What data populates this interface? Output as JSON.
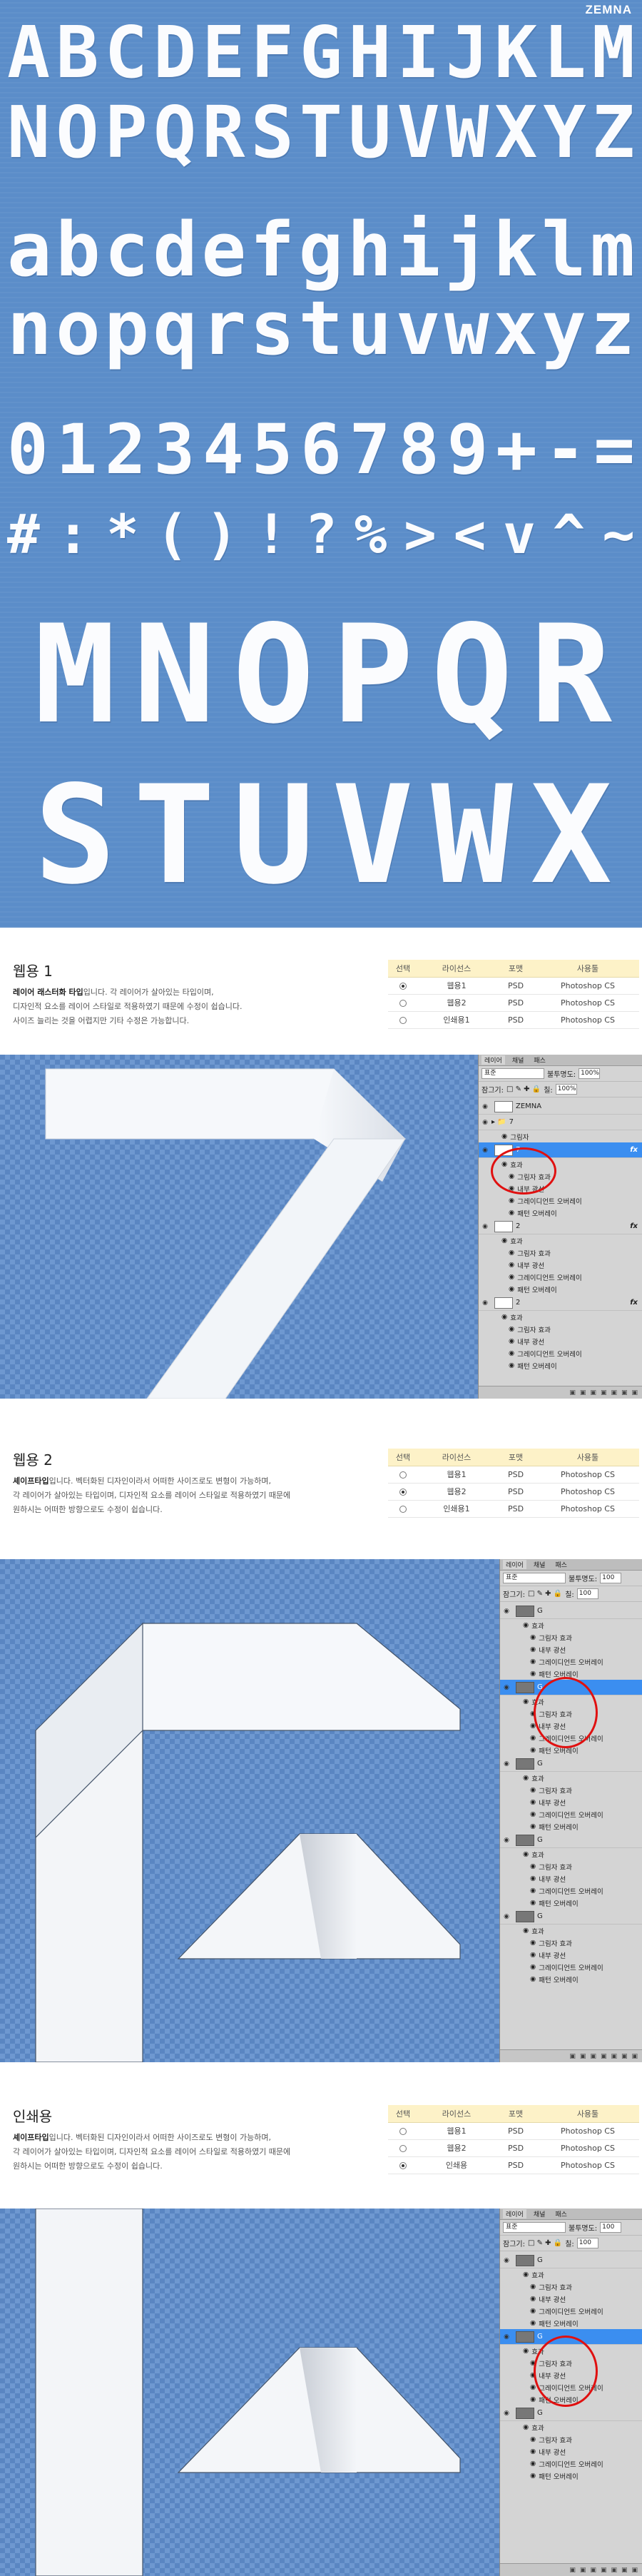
{
  "brand": "ZEMNA",
  "hero": {
    "upper1": [
      "A",
      "B",
      "C",
      "D",
      "E",
      "F",
      "G",
      "H",
      "I",
      "J",
      "K",
      "L",
      "M"
    ],
    "upper2": [
      "N",
      "O",
      "P",
      "Q",
      "R",
      "S",
      "T",
      "U",
      "V",
      "W",
      "X",
      "Y",
      "Z"
    ],
    "lower1": [
      "a",
      "b",
      "c",
      "d",
      "e",
      "f",
      "g",
      "h",
      "i",
      "j",
      "k",
      "l",
      "m"
    ],
    "lower2": [
      "n",
      "o",
      "p",
      "q",
      "r",
      "s",
      "t",
      "u",
      "v",
      "w",
      "x",
      "y",
      "z"
    ],
    "digits": [
      "0",
      "1",
      "2",
      "3",
      "4",
      "5",
      "6",
      "7",
      "8",
      "9",
      "+",
      "-",
      "="
    ],
    "symbols": [
      "#",
      ":",
      "*",
      "(",
      ")",
      "!",
      "?",
      "%",
      ">",
      "<",
      "v",
      "^",
      "~"
    ],
    "big1": [
      "M",
      "N",
      "O",
      "P",
      "Q",
      "R"
    ],
    "big2": [
      "S",
      "T",
      "U",
      "V",
      "W",
      "X"
    ]
  },
  "sections": [
    {
      "title": "웹용 1",
      "desc_bold": "레이어 래스터화 타입",
      "desc_line1": "입니다. 각 레이어가 살아있는 타입이며,",
      "desc_line2": "디자인적 요소를 레이어 스타일로 적용하였기 때문에 수정이 쉽습니다.",
      "desc_line3": "사이즈 늘리는 것을 어렵지만 기타 수정은 가능합니다.",
      "headers": [
        "선택",
        "라이선스",
        "포맷",
        "사용툴"
      ],
      "rows": [
        {
          "license": "웹용1",
          "format": "PSD",
          "tool": "Photoshop CS",
          "selected": true
        },
        {
          "license": "웹용2",
          "format": "PSD",
          "tool": "Photoshop CS",
          "selected": false
        },
        {
          "license": "인쇄용1",
          "format": "PSD",
          "tool": "Photoshop CS",
          "selected": false
        }
      ]
    },
    {
      "title": "웹용 2",
      "desc_bold": "셰이프타입",
      "desc_line1": "입니다. 벡터화된 디자인이라서 어떠한 사이즈로도 변형이 가능하며,",
      "desc_line2": "각 레이어가 살아있는 타입이며, 디자인적 요소를 레이어 스타일로 적용하였기 때문에",
      "desc_line3": "원하시는 어떠한 방향으로도 수정이 쉽습니다.",
      "headers": [
        "선택",
        "라이선스",
        "포맷",
        "사용툴"
      ],
      "rows": [
        {
          "license": "웹용1",
          "format": "PSD",
          "tool": "Photoshop CS",
          "selected": false
        },
        {
          "license": "웹용2",
          "format": "PSD",
          "tool": "Photoshop CS",
          "selected": true
        },
        {
          "license": "인쇄용1",
          "format": "PSD",
          "tool": "Photoshop CS",
          "selected": false
        }
      ]
    },
    {
      "title": "인쇄용",
      "desc_bold": "셰이프타입",
      "desc_line1": "입니다. 벡터화된 디자인이라서 어떠한 사이즈로도 변형이 가능하며,",
      "desc_line2": "각 레이어가 살아있는 타입이며, 디자인적 요소를 레이어 스타일로 적용하였기 때문에",
      "desc_line3": "원하시는 어떠한 방향으로도 수정이 쉽습니다.",
      "headers": [
        "선택",
        "라이선스",
        "포맷",
        "사용툴"
      ],
      "rows": [
        {
          "license": "웹용1",
          "format": "PSD",
          "tool": "Photoshop CS",
          "selected": false
        },
        {
          "license": "웹용2",
          "format": "PSD",
          "tool": "Photoshop CS",
          "selected": false
        },
        {
          "license": "인쇄용",
          "format": "PSD",
          "tool": "Photoshop CS",
          "selected": true
        }
      ]
    }
  ],
  "panels": [
    {
      "tabs": [
        "레이어",
        "채널",
        "패스"
      ],
      "blend": "표준",
      "opacity_label": "불투명도:",
      "opacity": "100%",
      "lock_label": "잠그기:",
      "fill_label": "칠:",
      "fill": "100%",
      "rows": [
        {
          "kind": "layer",
          "label": "ZEMNA",
          "fx": false,
          "selected": false,
          "thumb": "white"
        },
        {
          "kind": "group",
          "label": "7",
          "fx": false,
          "selected": false
        },
        {
          "kind": "sub",
          "label": "그림자",
          "fx": false,
          "selected": false
        },
        {
          "kind": "layer",
          "label": "7",
          "fx": true,
          "selected": true,
          "thumb": "white"
        },
        {
          "kind": "sub",
          "label": "효과",
          "fx": false,
          "selected": false
        },
        {
          "kind": "sub2",
          "label": "그림자 효과",
          "fx": false,
          "selected": false
        },
        {
          "kind": "sub2",
          "label": "내부 광선",
          "fx": false,
          "selected": false
        },
        {
          "kind": "sub2",
          "label": "그레이디언트 오버레이",
          "fx": false,
          "selected": false
        },
        {
          "kind": "sub2",
          "label": "패턴 오버레이",
          "fx": false,
          "selected": false
        },
        {
          "kind": "layer",
          "label": "2",
          "fx": true,
          "selected": false,
          "thumb": "white"
        },
        {
          "kind": "sub",
          "label": "효과",
          "fx": false,
          "selected": false
        },
        {
          "kind": "sub2",
          "label": "그림자 효과",
          "fx": false,
          "selected": false
        },
        {
          "kind": "sub2",
          "label": "내부 광선",
          "fx": false,
          "selected": false
        },
        {
          "kind": "sub2",
          "label": "그레이디언트 오버레이",
          "fx": false,
          "selected": false
        },
        {
          "kind": "sub2",
          "label": "패턴 오버레이",
          "fx": false,
          "selected": false
        },
        {
          "kind": "layer",
          "label": "2",
          "fx": true,
          "selected": false,
          "thumb": "white"
        },
        {
          "kind": "sub",
          "label": "효과",
          "fx": false,
          "selected": false
        },
        {
          "kind": "sub2",
          "label": "그림자 효과",
          "fx": false,
          "selected": false
        },
        {
          "kind": "sub2",
          "label": "내부 광선",
          "fx": false,
          "selected": false
        },
        {
          "kind": "sub2",
          "label": "그레이디언트 오버레이",
          "fx": false,
          "selected": false
        },
        {
          "kind": "sub2",
          "label": "패턴 오버레이",
          "fx": false,
          "selected": false
        }
      ]
    },
    {
      "tabs": [
        "레이어",
        "채널",
        "패스"
      ],
      "blend": "표준",
      "opacity_label": "불투명도:",
      "opacity": "100",
      "lock_label": "잠그기:",
      "fill_label": "칠:",
      "fill": "100",
      "rows": [
        {
          "kind": "layer",
          "label": "G",
          "fx": false,
          "selected": false,
          "thumb": "gray"
        },
        {
          "kind": "sub",
          "label": "효과",
          "fx": false,
          "selected": false
        },
        {
          "kind": "sub2",
          "label": "그림자 효과",
          "fx": false,
          "selected": false
        },
        {
          "kind": "sub2",
          "label": "내부 광선",
          "fx": false,
          "selected": false
        },
        {
          "kind": "sub2",
          "label": "그레이디언트 오버레이",
          "fx": false,
          "selected": false
        },
        {
          "kind": "sub2",
          "label": "패턴 오버레이",
          "fx": false,
          "selected": false
        },
        {
          "kind": "layer",
          "label": "G",
          "fx": false,
          "selected": true,
          "thumb": "gray"
        },
        {
          "kind": "sub",
          "label": "효과",
          "fx": false,
          "selected": false
        },
        {
          "kind": "sub2",
          "label": "그림자 효과",
          "fx": false,
          "selected": false
        },
        {
          "kind": "sub2",
          "label": "내부 광선",
          "fx": false,
          "selected": false
        },
        {
          "kind": "sub2",
          "label": "그레이디언트 오버레이",
          "fx": false,
          "selected": false
        },
        {
          "kind": "sub2",
          "label": "패턴 오버레이",
          "fx": false,
          "selected": false
        },
        {
          "kind": "layer",
          "label": "G",
          "fx": false,
          "selected": false,
          "thumb": "gray"
        },
        {
          "kind": "sub",
          "label": "효과",
          "fx": false,
          "selected": false
        },
        {
          "kind": "sub2",
          "label": "그림자 효과",
          "fx": false,
          "selected": false
        },
        {
          "kind": "sub2",
          "label": "내부 광선",
          "fx": false,
          "selected": false
        },
        {
          "kind": "sub2",
          "label": "그레이디언트 오버레이",
          "fx": false,
          "selected": false
        },
        {
          "kind": "sub2",
          "label": "패턴 오버레이",
          "fx": false,
          "selected": false
        },
        {
          "kind": "layer",
          "label": "G",
          "fx": false,
          "selected": false,
          "thumb": "gray"
        },
        {
          "kind": "sub",
          "label": "효과",
          "fx": false,
          "selected": false
        },
        {
          "kind": "sub2",
          "label": "그림자 효과",
          "fx": false,
          "selected": false
        },
        {
          "kind": "sub2",
          "label": "내부 광선",
          "fx": false,
          "selected": false
        },
        {
          "kind": "sub2",
          "label": "그레이디언트 오버레이",
          "fx": false,
          "selected": false
        },
        {
          "kind": "sub2",
          "label": "패턴 오버레이",
          "fx": false,
          "selected": false
        },
        {
          "kind": "layer",
          "label": "G",
          "fx": false,
          "selected": false,
          "thumb": "gray"
        },
        {
          "kind": "sub",
          "label": "효과",
          "fx": false,
          "selected": false
        },
        {
          "kind": "sub2",
          "label": "그림자 효과",
          "fx": false,
          "selected": false
        },
        {
          "kind": "sub2",
          "label": "내부 광선",
          "fx": false,
          "selected": false
        },
        {
          "kind": "sub2",
          "label": "그레이디언트 오버레이",
          "fx": false,
          "selected": false
        },
        {
          "kind": "sub2",
          "label": "패턴 오버레이",
          "fx": false,
          "selected": false
        }
      ]
    },
    {
      "tabs": [
        "레이어",
        "채널",
        "패스"
      ],
      "blend": "표준",
      "opacity_label": "불투명도:",
      "opacity": "100",
      "lock_label": "잠그기:",
      "fill_label": "칠:",
      "fill": "100",
      "rows": [
        {
          "kind": "layer",
          "label": "G",
          "fx": false,
          "selected": false,
          "thumb": "gray"
        },
        {
          "kind": "sub",
          "label": "효과",
          "fx": false,
          "selected": false
        },
        {
          "kind": "sub2",
          "label": "그림자 효과",
          "fx": false,
          "selected": false
        },
        {
          "kind": "sub2",
          "label": "내부 광선",
          "fx": false,
          "selected": false
        },
        {
          "kind": "sub2",
          "label": "그레이디언트 오버레이",
          "fx": false,
          "selected": false
        },
        {
          "kind": "sub2",
          "label": "패턴 오버레이",
          "fx": false,
          "selected": false
        },
        {
          "kind": "layer",
          "label": "G",
          "fx": false,
          "selected": true,
          "thumb": "gray"
        },
        {
          "kind": "sub",
          "label": "효과",
          "fx": false,
          "selected": false
        },
        {
          "kind": "sub2",
          "label": "그림자 효과",
          "fx": false,
          "selected": false
        },
        {
          "kind": "sub2",
          "label": "내부 광선",
          "fx": false,
          "selected": false
        },
        {
          "kind": "sub2",
          "label": "그레이디언트 오버레이",
          "fx": false,
          "selected": false
        },
        {
          "kind": "sub2",
          "label": "패턴 오버레이",
          "fx": false,
          "selected": false
        },
        {
          "kind": "layer",
          "label": "G",
          "fx": false,
          "selected": false,
          "thumb": "gray"
        },
        {
          "kind": "sub",
          "label": "효과",
          "fx": false,
          "selected": false
        },
        {
          "kind": "sub2",
          "label": "그림자 효과",
          "fx": false,
          "selected": false
        },
        {
          "kind": "sub2",
          "label": "내부 광선",
          "fx": false,
          "selected": false
        },
        {
          "kind": "sub2",
          "label": "그레이디언트 오버레이",
          "fx": false,
          "selected": false
        },
        {
          "kind": "sub2",
          "label": "패턴 오버레이",
          "fx": false,
          "selected": false
        }
      ]
    }
  ],
  "colors": {
    "hero_bg": "#5b8dc9",
    "canvas_bg": "#5a86c2",
    "table_header": "#fdf2c8",
    "selection": "#3b8ef0",
    "marker": "#e01010"
  }
}
